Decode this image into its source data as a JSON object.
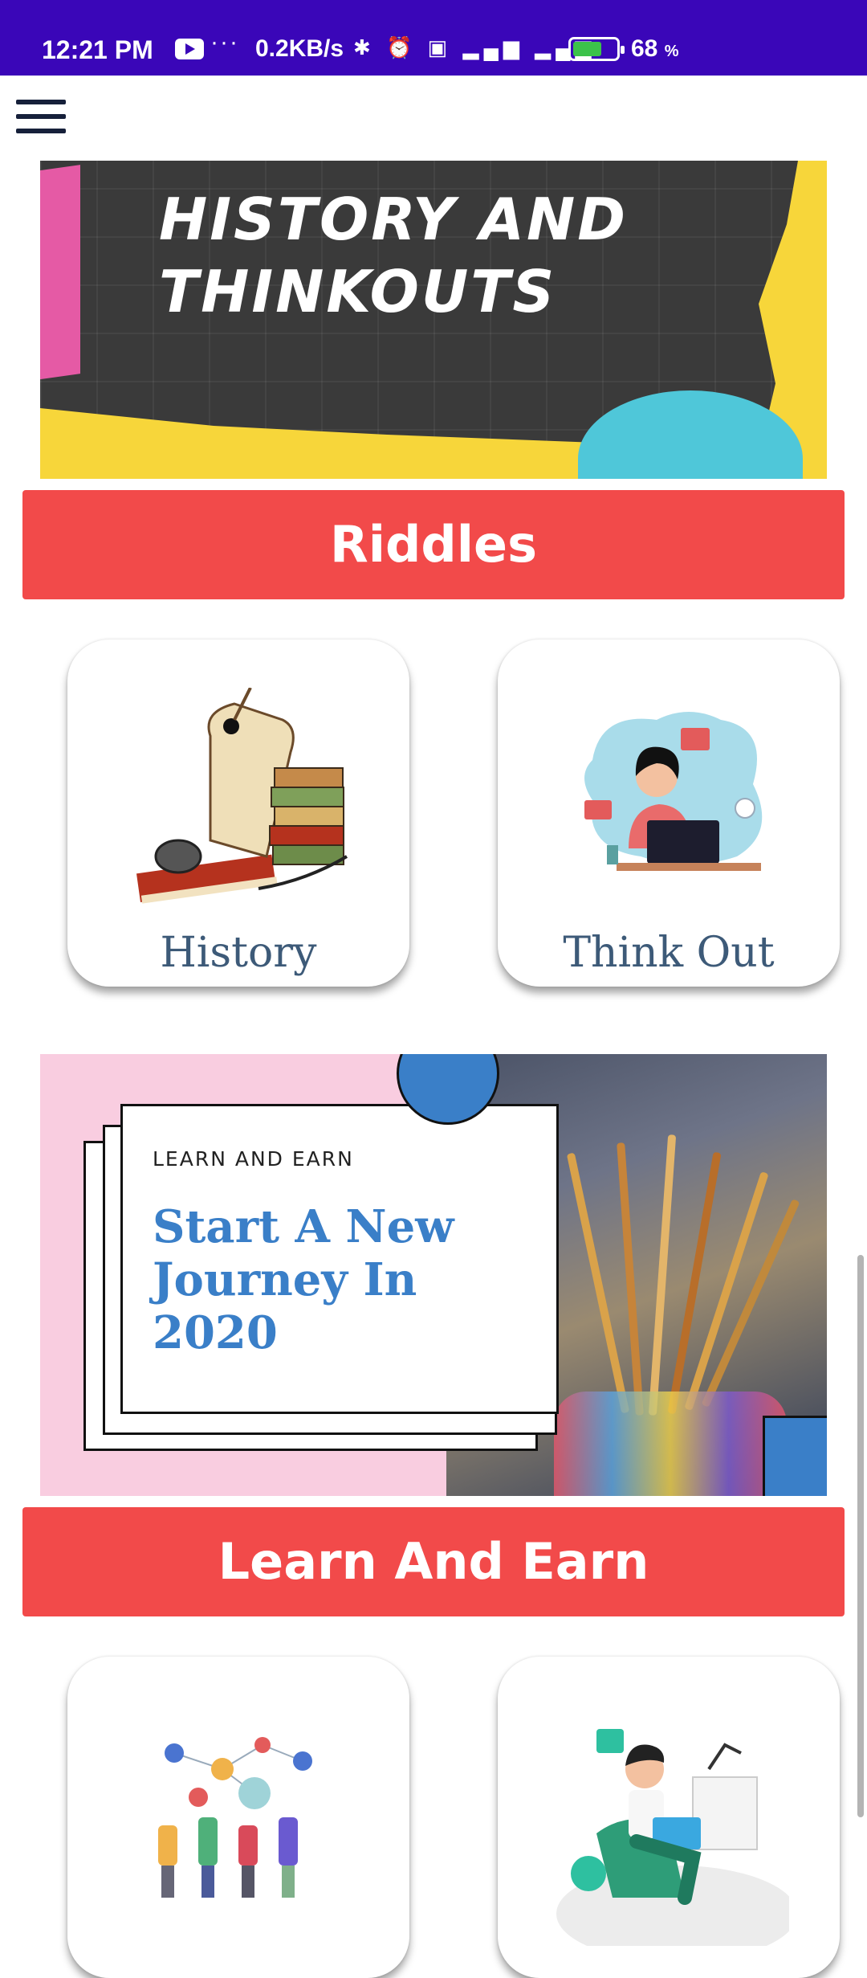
{
  "status_bar": {
    "time": "12:21 PM",
    "dots": "···",
    "speed": "0.2KB/s",
    "battery_pct": "68",
    "battery_unit": "%",
    "battery_level": 0.68,
    "icons": [
      "youtube-icon",
      "bluetooth-icon",
      "alarm-icon",
      "volte-icon",
      "signal-4g-icon",
      "signal-icon",
      "battery-charging-icon"
    ]
  },
  "colors": {
    "status_bar": "#3a06b8",
    "red_header": "#f24a4a",
    "card_label": "#3d5a78",
    "headline_blue": "#3a7fc8"
  },
  "banner1": {
    "title_line1": "HISTORY AND",
    "title_line2": "THINKOUTS"
  },
  "section1": {
    "title": "Riddles"
  },
  "cards1": [
    {
      "label": "History"
    },
    {
      "label": "Think Out"
    }
  ],
  "banner2": {
    "kicker": "LEARN AND EARN",
    "headline": "Start A New Journey In 2020"
  },
  "section2": {
    "title": "Learn And Earn"
  },
  "cards2": [
    {
      "label": ""
    },
    {
      "label": ""
    }
  ]
}
